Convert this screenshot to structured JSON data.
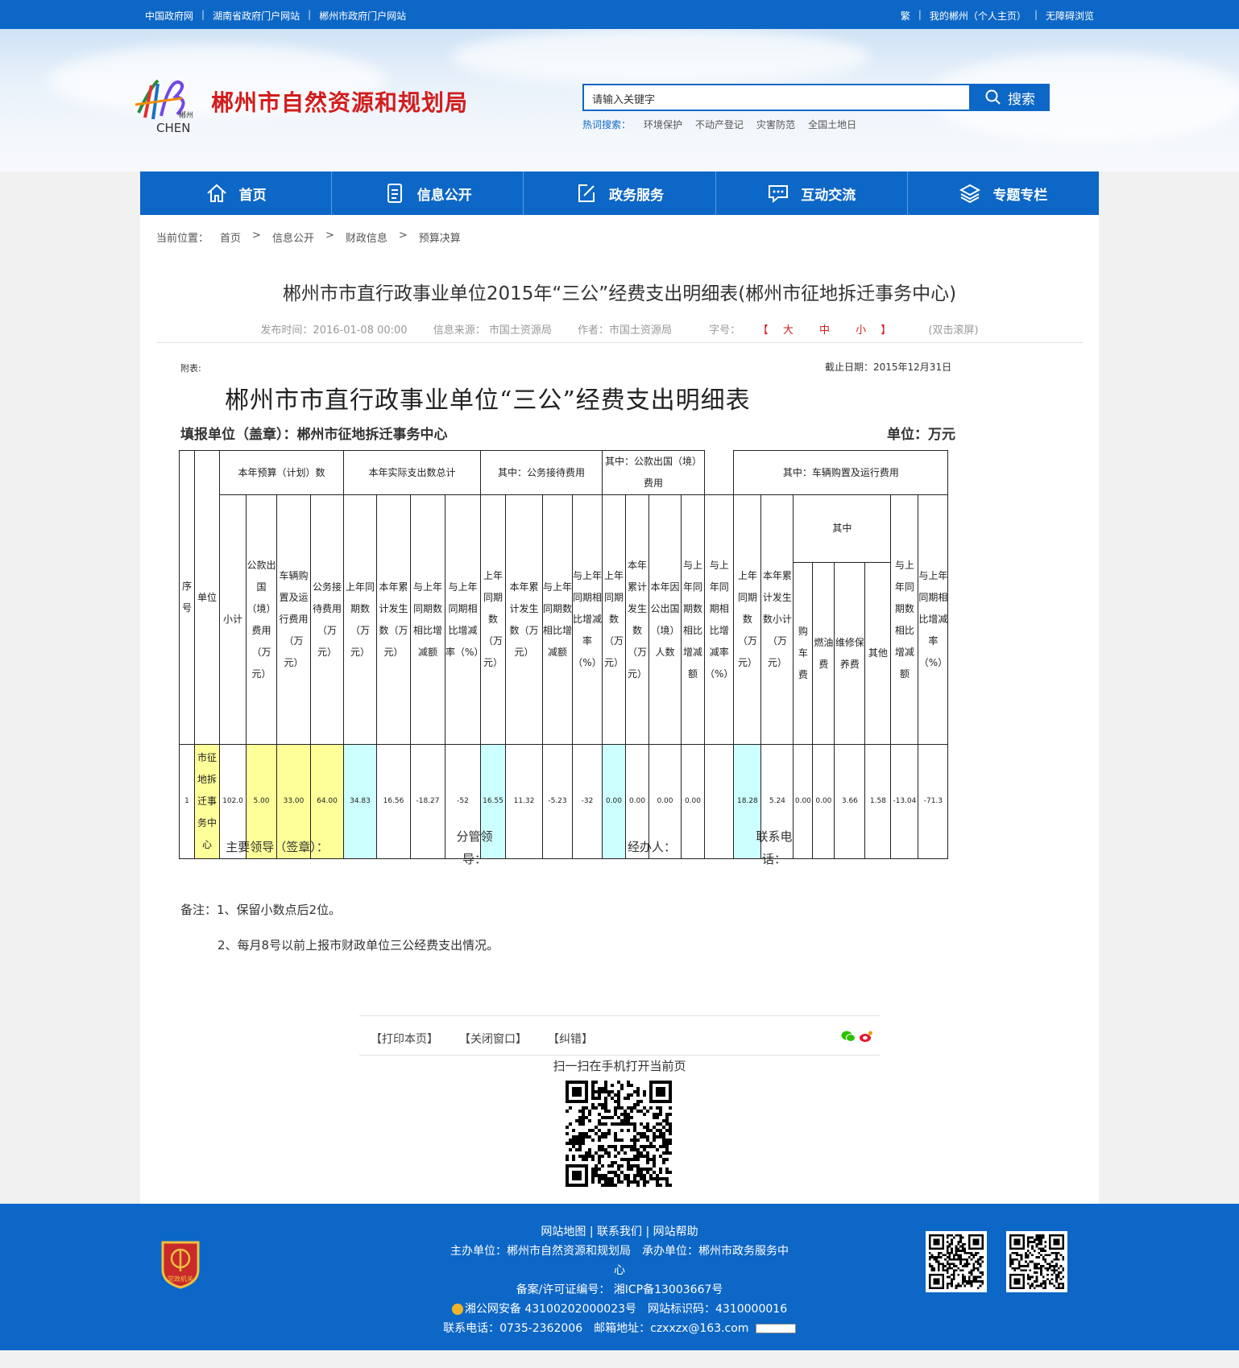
{
  "topbar": {
    "left_links": [
      "中国政府网",
      "湖南省政府门户网站",
      "郴州市政府门户网站"
    ],
    "right_links": [
      "繁",
      "我的郴州（个人主页）",
      "无障碍浏览"
    ]
  },
  "header": {
    "site_title": "郴州市自然资源和规划局",
    "search_placeholder": "请输入关键字",
    "search_button": "搜索",
    "hot_label": "热词搜索：",
    "hot_words": [
      "环境保护",
      "不动产登记",
      "灾害防范",
      "全国土地日"
    ]
  },
  "nav": [
    {
      "label": "首页",
      "icon": "home-icon"
    },
    {
      "label": "信息公开",
      "icon": "document-icon"
    },
    {
      "label": "政务服务",
      "icon": "edit-icon"
    },
    {
      "label": "互动交流",
      "icon": "chat-icon"
    },
    {
      "label": "专题专栏",
      "icon": "layers-icon"
    }
  ],
  "breadcrumb": {
    "label": "当前位置：",
    "items": [
      "首页",
      "信息公开",
      "财政信息",
      "预算决算"
    ],
    "separator": ">"
  },
  "article": {
    "title": "郴州市市直行政事业单位2015年“三公”经费支出明细表(郴州市征地拆迁事务中心)",
    "publish_time": "发布时间：2016-01-08 00:00",
    "source": "信息来源： 市国土资源局",
    "author": "作者：市国土资源局",
    "font_size_label": "字号：",
    "font_sizes": [
      "大",
      "中",
      "小"
    ],
    "scroll_hint": "(双击滚屏)"
  },
  "doc": {
    "attach_label": "附表:",
    "deadline": "截止日期：2015年12月31日",
    "title": "郴州市市直行政事业单位“三公”经费支出明细表",
    "fill_unit": "填报单位（盖章）：郴州市征地拆迁事务中心",
    "unit": "单位：万元",
    "group_headers": {
      "budget": "本年预算（计划）数",
      "actual": "本年实际支出数总计",
      "reception": "其中：公务接待费用",
      "abroad": "其中：公款出国（境）费用",
      "vehicle": "其中：车辆购置及运行费用",
      "vehicle_sub": "其中"
    },
    "col_headers": {
      "seq": "序号",
      "unit_name": "单位",
      "subtotal": "小计",
      "b_abroad": "公款出国（境）费用（万元）",
      "b_vehicle": "车辆购置及运行费用（万元）",
      "b_reception": "公务接待费用（万元）",
      "a_last": "上年同期数（万元）",
      "a_total": "本年累计发生数（万元）",
      "a_diff": "与上年同期数相比增减额",
      "a_rate": "与上年同期相比增减率（%）",
      "r_last": "上年同期数（万元）",
      "r_total": "本年累计发生数（万元）",
      "r_diff": "与上年同期数相比增减额",
      "r_rate": "与上年同期相比增减率（%）",
      "o_last": "上年同期数（万元）",
      "o_total": "本年累计发生数（万元）",
      "o_people": "本年因公出国（境）人数",
      "o_diff": "与上年同期数相比增减额",
      "o_rate": "与上年同期相比增减率（%）",
      "v_last": "上年同期数（万元）",
      "v_total": "本年累计发生数小计（万元）",
      "v_buy": "购车费",
      "v_fuel": "燃油费",
      "v_repair": "维修保养费",
      "v_other": "其他",
      "v_diff": "与上年同期数相比增减额",
      "v_rate": "与上年同期相比增减率（%）"
    },
    "row": {
      "seq": "1",
      "name": "市征地拆迁事务中心",
      "subtotal": "102.0",
      "b_abroad": "5.00",
      "b_vehicle": "33.00",
      "b_reception": "64.00",
      "a_last": "34.83",
      "a_total": "16.56",
      "a_diff": "-18.27",
      "a_rate": "-52",
      "r_last": "16.55",
      "r_total": "11.32",
      "r_diff": "-5.23",
      "r_rate": "-32",
      "o_last": "0.00",
      "o_total": "0.00",
      "o_people": "0.00",
      "o_diff": "0.00",
      "o_rate": "",
      "v_last": "18.28",
      "v_total": "5.24",
      "v_buy": "0.00",
      "v_fuel": "0.00",
      "v_repair": "3.66",
      "v_other": "1.58",
      "v_diff": "-13.04",
      "v_rate": "-71.3"
    },
    "sign": {
      "leader": "主要领导（签章）：",
      "supervisor": "分管领导：",
      "handler": "经办人：",
      "phone": "联系电话："
    },
    "notes": [
      "备注：1、保留小数点后2位。",
      "2、每月8号以前上报市财政单位三公经费支出情况。"
    ]
  },
  "actions": [
    "【打印本页】",
    "【关闭窗口】",
    "【纠错】"
  ],
  "scan_text": "扫一扫在手机打开当前页",
  "footer": {
    "links": "网站地图 | 联系我们 | 网站帮助",
    "host": "主办单位：郴州市自然资源和规划局　承办单位：郴州市政务服务中",
    "host_cont": "心",
    "icp": "备案/许可证编号： 湘ICP备13003667号",
    "police": "湘公网安备 43100202000023号　网站标识码：4310000016",
    "contact": "联系电话：0735-2362006　邮箱地址：czxxzx@163.com",
    "badge_text": "党政机关"
  },
  "colors": {
    "brand_blue": "#0d67c6",
    "title_red": "#d21d1d",
    "yellow_cell": "#ffff99",
    "cyan_cell": "#ccffff"
  }
}
